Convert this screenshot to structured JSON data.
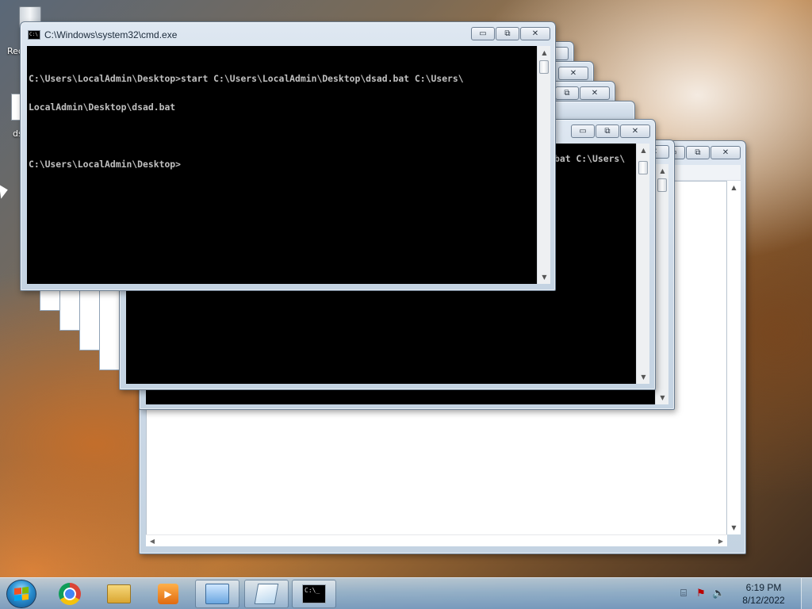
{
  "desktop": {
    "recycle_bin_label": "Rec",
    "file_label": "ds"
  },
  "main_window": {
    "title": "C:\\Windows\\system32\\cmd.exe",
    "console_lines": [
      "C:\\Users\\LocalAdmin\\Desktop>start C:\\Users\\LocalAdmin\\Desktop\\dsad.bat C:\\Users\\",
      "LocalAdmin\\Desktop\\dsad.bat",
      "",
      "C:\\Users\\LocalAdmin\\Desktop>"
    ]
  },
  "background_window": {
    "console_fragment": "bat C:\\Users\\"
  },
  "caption_buttons": {
    "minimize": "▭",
    "maximize": "⧉",
    "close": "✕"
  },
  "taskbar": {
    "clock_time": "6:19 PM",
    "clock_date": "8/12/2022",
    "cmd_icon_text": "C:\\_",
    "icons": [
      "windows-start-icon",
      "chrome-icon",
      "folder-icon",
      "media-player-icon",
      "control-panel-icon",
      "notepad-icon",
      "cmd-icon"
    ],
    "tray_icons": [
      "network-icon",
      "action-center-icon",
      "volume-icon"
    ]
  }
}
